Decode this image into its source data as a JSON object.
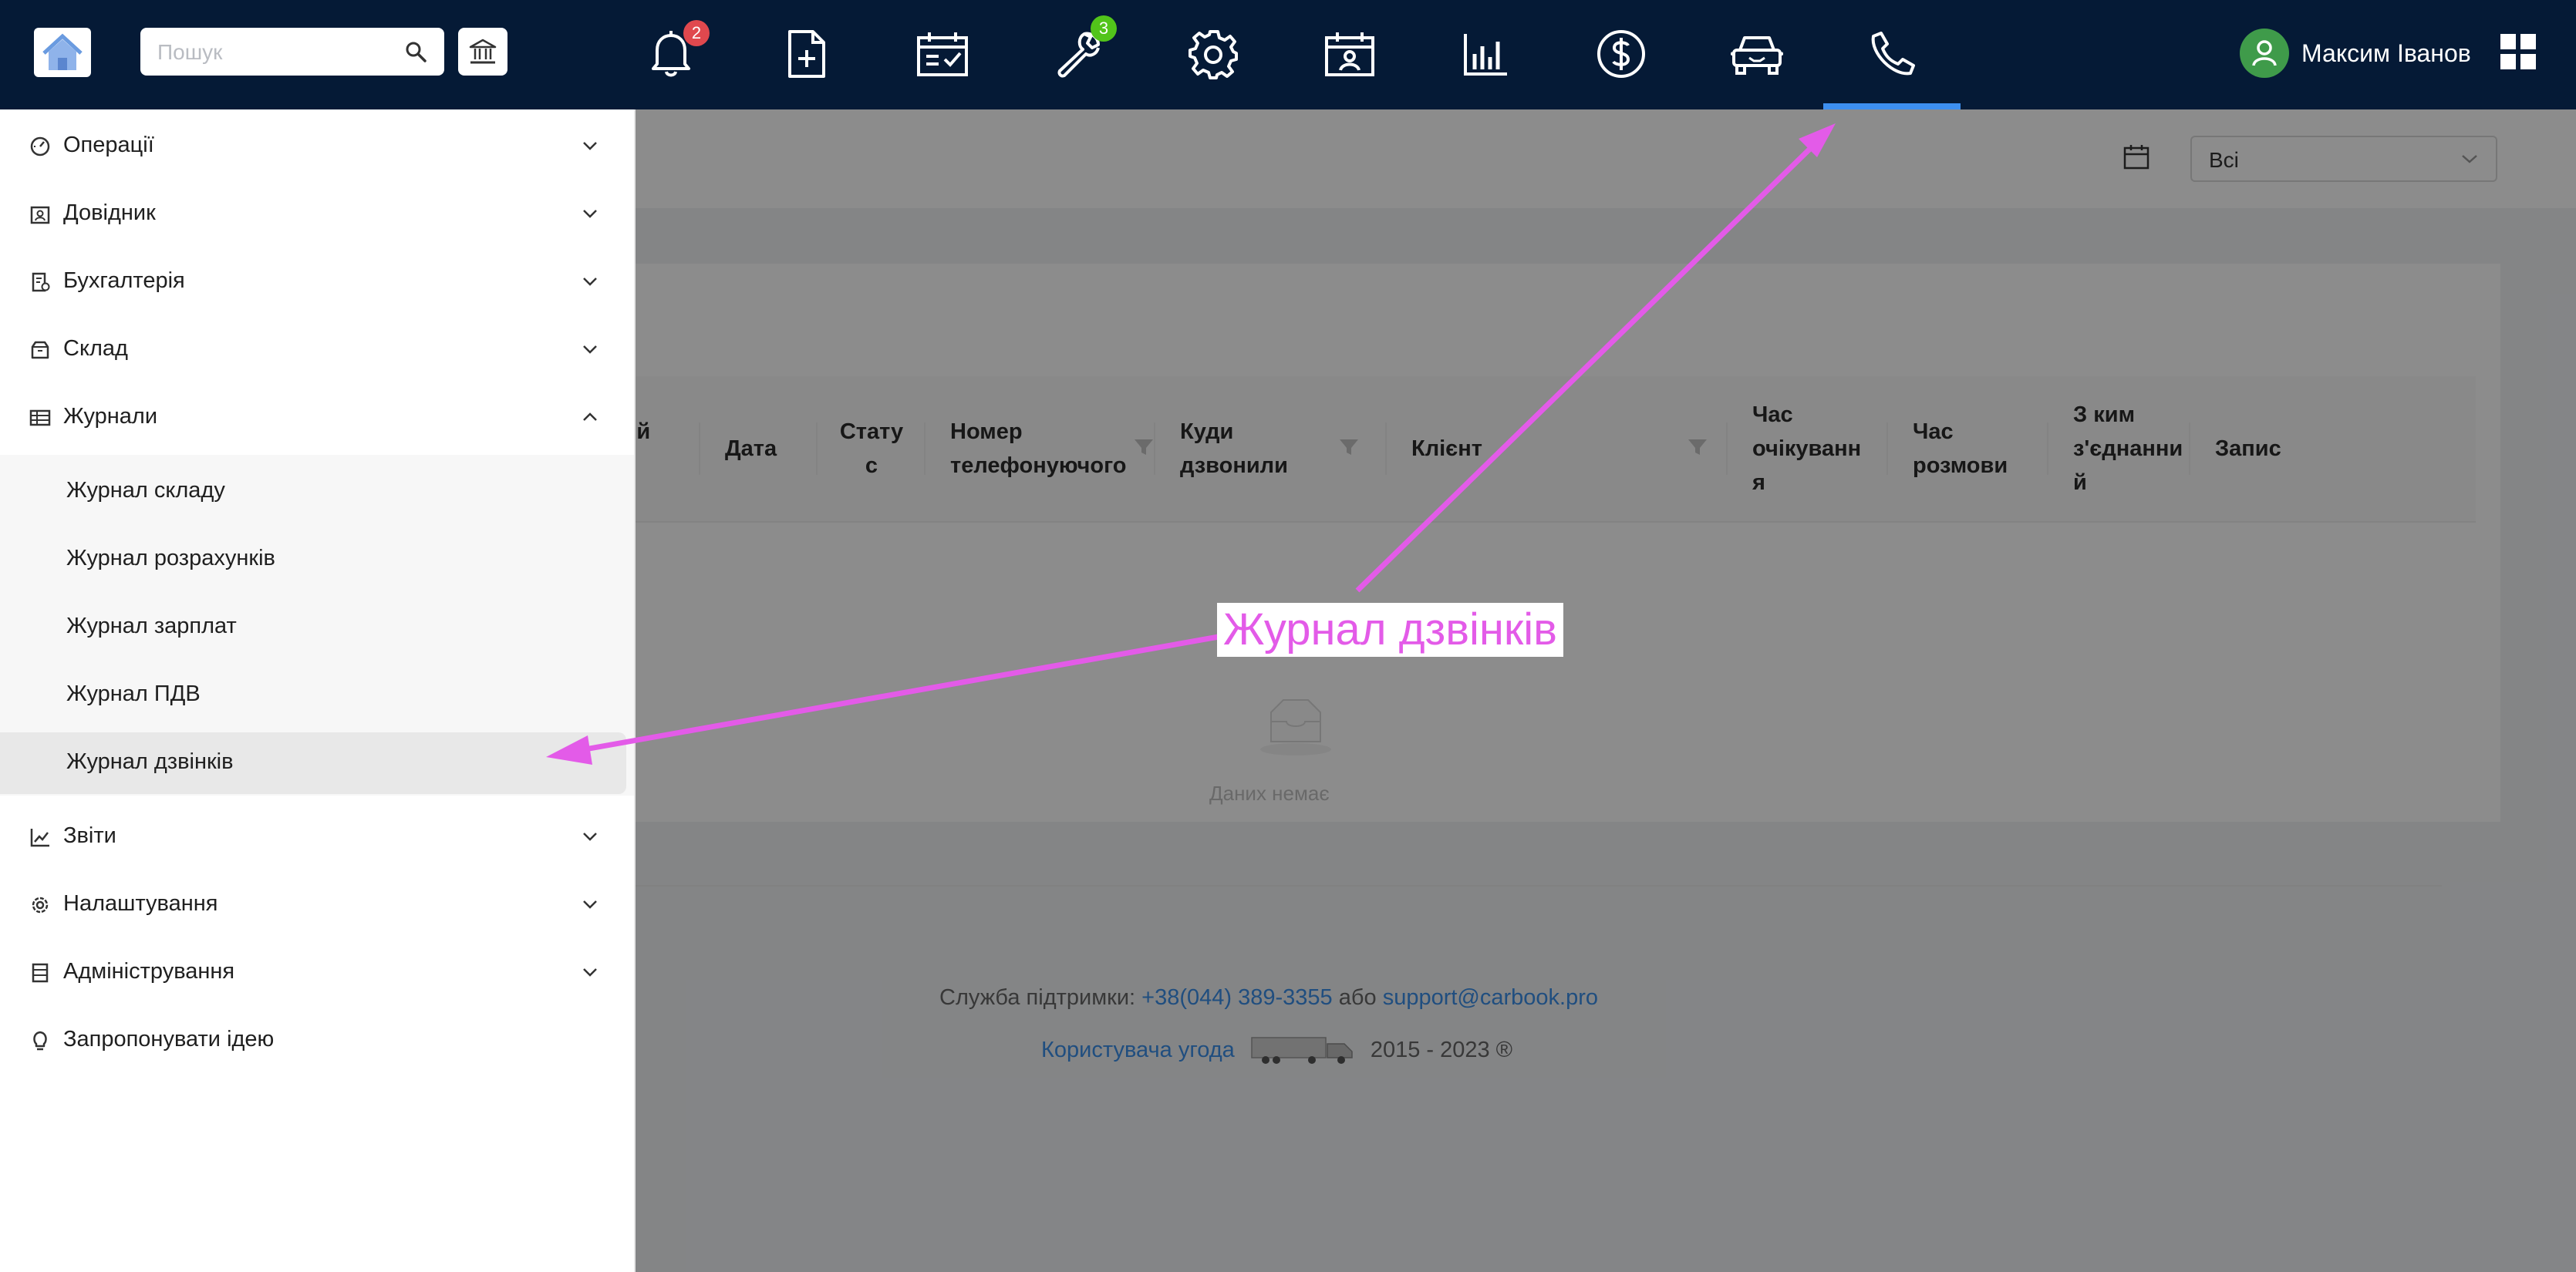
{
  "search": {
    "placeholder": "Пошук"
  },
  "topbar": {
    "notifications_count": "2",
    "tasks_count": "3",
    "nav_icons": [
      "bell-icon",
      "add-document-icon",
      "calendar-check-icon",
      "wrench-icon",
      "gear-icon",
      "calendar-person-icon",
      "bar-chart-icon",
      "dollar-icon",
      "car-icon",
      "phone-icon"
    ],
    "active_item": "phone-icon"
  },
  "user": {
    "name": "Максим Іванов"
  },
  "filters": {
    "status_selected": "Всі"
  },
  "table": {
    "columns": [
      {
        "label": "ний\nр"
      },
      {
        "label": "Дата"
      },
      {
        "label": "Стату\nс"
      },
      {
        "label": "Номер\nтелефонуючого"
      },
      {
        "label": "Куди\nдзвонили"
      },
      {
        "label": "Клієнт"
      },
      {
        "label": "Час\nочікуванн\nя"
      },
      {
        "label": "Час\nрозмови"
      },
      {
        "label": "З ким\nз'єднанни\nй"
      },
      {
        "label": "Запис"
      }
    ],
    "empty_text": "Даних немає"
  },
  "footer": {
    "support_label": "Служба підтримки:",
    "phone": "+38(044) 389-3355",
    "or_text": "або",
    "email": "support@carbook.pro",
    "agreement": "Користувача угода",
    "years": "2015 - 2023 ®"
  },
  "sidebar": {
    "items": [
      {
        "label": "Операції",
        "icon": "gauge-icon"
      },
      {
        "label": "Довідник",
        "icon": "contacts-icon"
      },
      {
        "label": "Бухгалтерія",
        "icon": "accounting-icon"
      },
      {
        "label": "Склад",
        "icon": "box-icon"
      },
      {
        "label": "Журнали",
        "icon": "table-icon"
      },
      {
        "label": "Звіти",
        "icon": "line-chart-icon"
      },
      {
        "label": "Налаштування",
        "icon": "gear-icon"
      },
      {
        "label": "Адміністрування",
        "icon": "database-icon"
      },
      {
        "label": "Запропонувати ідею",
        "icon": "bulb-icon"
      }
    ],
    "journals": [
      {
        "label": "Журнал складу"
      },
      {
        "label": "Журнал розрахунків"
      },
      {
        "label": "Журнал зарплат"
      },
      {
        "label": "Журнал ПДВ"
      },
      {
        "label": "Журнал дзвінків"
      }
    ]
  },
  "annotation": {
    "text": "Журнал дзвінків",
    "color": "#e35be8"
  }
}
